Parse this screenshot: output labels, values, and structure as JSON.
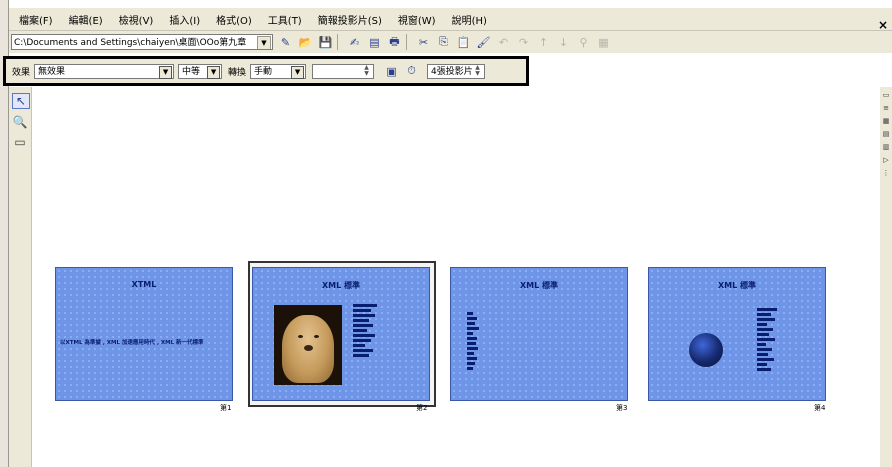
{
  "menubar": {
    "items": [
      "檔案(F)",
      "編輯(E)",
      "檢視(V)",
      "插入(I)",
      "格式(O)",
      "工具(T)",
      "簡報投影片(S)",
      "視窗(W)",
      "說明(H)"
    ],
    "close": "×"
  },
  "toolbar1": {
    "path": "C:\\Documents and Settings\\chaiyen\\桌面\\OOo第九章"
  },
  "toolbar2": {
    "effect_label": "效果",
    "effect_value": "無效果",
    "speed_value": "中等",
    "switch_label": "轉換",
    "switch_value": "手動",
    "time_value": "",
    "slides_per_row": "4張投影片"
  },
  "slides": [
    {
      "title": "XTML",
      "body": "以XTML 為準據  ,  XML 加速應用時代  ,  XML 新一代標準",
      "number": "第1"
    },
    {
      "title": "XML 標準",
      "number": "第2"
    },
    {
      "title": "XML 標準",
      "number": "第3"
    },
    {
      "title": "XML 標準",
      "number": "第4"
    }
  ]
}
